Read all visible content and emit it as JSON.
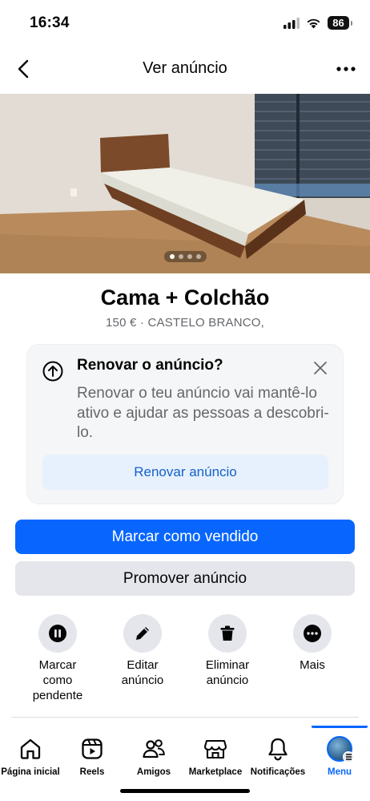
{
  "status_bar": {
    "time": "16:34",
    "battery": "86"
  },
  "nav": {
    "title": "Ver anúncio"
  },
  "photo": {
    "page_count": 4,
    "active_page": 1
  },
  "listing": {
    "title": "Cama + Colchão",
    "subtitle": "150 € · CASTELO BRANCO,"
  },
  "renew_card": {
    "title": "Renovar o anúncio?",
    "text": "Renovar o teu anúncio vai mantê-lo ativo e ajudar as pessoas a descobri-lo.",
    "button_label": "Renovar anúncio"
  },
  "buttons": {
    "primary": "Marcar como vendido",
    "secondary": "Promover anúncio"
  },
  "actions": [
    {
      "label": "Marcar\ncomo\npendente",
      "icon": "pause-icon"
    },
    {
      "label": "Editar\nanúncio",
      "icon": "pencil-icon"
    },
    {
      "label": "Eliminar\nanúncio",
      "icon": "trash-icon"
    },
    {
      "label": "Mais",
      "icon": "more-icon"
    }
  ],
  "tabs": [
    {
      "label": "Página inicial",
      "icon": "home-icon"
    },
    {
      "label": "Reels",
      "icon": "reels-icon"
    },
    {
      "label": "Amigos",
      "icon": "friends-icon"
    },
    {
      "label": "Marketplace",
      "icon": "marketplace-icon"
    },
    {
      "label": "Notificações",
      "icon": "bell-icon"
    },
    {
      "label": "Menu",
      "icon": "avatar",
      "active": true
    }
  ],
  "colors": {
    "accent": "#0866ff",
    "secondary_button": "#e4e6eb",
    "muted_text": "#65676b",
    "renew_button_bg": "#e7f1fd",
    "renew_button_text": "#1461c9"
  }
}
